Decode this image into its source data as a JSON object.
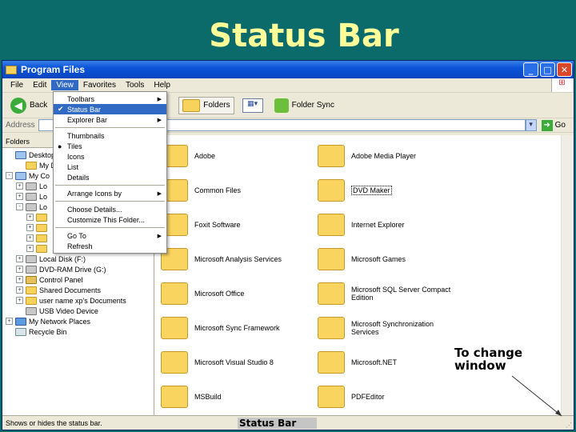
{
  "slide": {
    "title": "Status Bar"
  },
  "window": {
    "title": "Program Files",
    "buttons": [
      "_",
      "□",
      "✕"
    ]
  },
  "menubar": {
    "items": [
      "File",
      "Edit",
      "View",
      "Favorites",
      "Tools",
      "Help"
    ],
    "active": "View"
  },
  "toolbar": {
    "back": "Back",
    "folders": "Folders",
    "folder_sync": "Folder Sync"
  },
  "address": {
    "label": "Address",
    "value": "",
    "go": "Go"
  },
  "tree": {
    "header": "Folders",
    "items": [
      {
        "label": "Desktop",
        "icon": "desktop"
      },
      {
        "label": "My Do",
        "icon": "folder"
      },
      {
        "label": "My Co",
        "icon": "computer"
      },
      {
        "label": "Lo",
        "icon": "drive"
      },
      {
        "label": "Lo",
        "icon": "drive"
      },
      {
        "label": "Lo",
        "icon": "drive"
      },
      {
        "label": "",
        "icon": "folder"
      },
      {
        "label": "",
        "icon": "folder"
      },
      {
        "label": "",
        "icon": "folder"
      },
      {
        "label": "",
        "icon": "folder"
      },
      {
        "label": "Local Disk (F:)",
        "icon": "drive"
      },
      {
        "label": "DVD-RAM Drive (G:)",
        "icon": "drive"
      },
      {
        "label": "Control Panel",
        "icon": "control-panel"
      },
      {
        "label": "Shared Documents",
        "icon": "folder"
      },
      {
        "label": "user name xp's Documents",
        "icon": "folder"
      },
      {
        "label": "USB Video Device",
        "icon": "device"
      },
      {
        "label": "My Network Places",
        "icon": "network"
      },
      {
        "label": "Recycle Bin",
        "icon": "recycle-bin"
      }
    ]
  },
  "view_menu": {
    "items": [
      {
        "label": "Toolbars",
        "submenu": true
      },
      {
        "label": "Status Bar",
        "checked": true,
        "highlighted": true
      },
      {
        "label": "Explorer Bar",
        "submenu": true
      },
      {
        "separator": true
      },
      {
        "label": "Thumbnails"
      },
      {
        "label": "Tiles",
        "radio": true
      },
      {
        "label": "Icons"
      },
      {
        "label": "List"
      },
      {
        "label": "Details"
      },
      {
        "separator": true
      },
      {
        "label": "Arrange Icons by",
        "submenu": true
      },
      {
        "separator": true
      },
      {
        "label": "Choose Details..."
      },
      {
        "label": "Customize This Folder..."
      },
      {
        "separator": true
      },
      {
        "label": "Go To",
        "submenu": true
      },
      {
        "label": "Refresh"
      }
    ]
  },
  "folders": [
    [
      "Adobe",
      "Adobe Media Player"
    ],
    [
      "Common Files",
      "DVD Maker"
    ],
    [
      "Foxit Software",
      "Internet Explorer"
    ],
    [
      "Microsoft Analysis Services",
      "Microsoft Games"
    ],
    [
      "Microsoft Office",
      "Microsoft SQL Server Compact Edition"
    ],
    [
      "Microsoft Sync Framework",
      "Microsoft Synchronization Services"
    ],
    [
      "Microsoft Visual Studio 8",
      "Microsoft.NET"
    ],
    [
      "MSBuild",
      "PDFEditor"
    ]
  ],
  "statusbar": {
    "text": "Shows or hides the status bar.",
    "label": "Status Bar"
  },
  "annotation": {
    "line1": "To change",
    "line2": "window"
  }
}
